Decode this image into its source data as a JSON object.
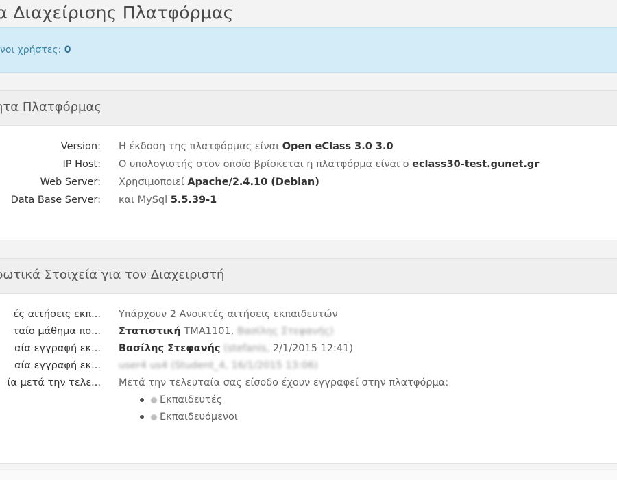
{
  "page_title": "εία Διαχείρισης Πλατφόρμας",
  "alert": {
    "label": "εμένοι χρήστες:",
    "value": "0"
  },
  "platform_panel": {
    "title": "ητα Πλατφόρμας",
    "rows": [
      {
        "label": "Version:",
        "text": "Η έκδοση της πλατφόρμας είναι",
        "bold": "Open eClass 3.0 3.0",
        "after": ""
      },
      {
        "label": "IP Host:",
        "text": "Ο υπολογιστής στον οποίο βρίσκεται η πλατφόρμα είναι ο",
        "bold": "eclass30-test.gunet.gr",
        "after": ""
      },
      {
        "label": "Web Server:",
        "text": "Χρησιμοποιεί",
        "bold": "Apache/2.4.10 (Debian)",
        "after": ""
      },
      {
        "label": "Data Base Server:",
        "text": "και MySql",
        "bold": "5.5.39-1",
        "after": ""
      }
    ]
  },
  "admin_panel": {
    "title": "ρωτικά Στοιχεία για τον Διαχειριστή",
    "rows": [
      {
        "label": "ές αιτήσεις εκπ...",
        "text": "Υπάρχουν 2 Ανοικτές αιτήσεις εκπαιδευτών"
      },
      {
        "label": "ταίο μάθημα πο...",
        "bold": "Στατιστική",
        "text": "TMA1101,",
        "blurred": "Βασίλης Στεφανής)"
      },
      {
        "label": "αία εγγραφή εκ...",
        "bold": "Βασίλης Στεφανής",
        "blurred": "(stefanis,",
        "text": "2/1/2015 12:41)"
      },
      {
        "label": "αία εγγραφή εκ...",
        "blurred": "user4 us4 (Student_4, 16/1/2015 13:06)"
      },
      {
        "label": "ία μετά την τελε...",
        "text": "Μετά την τελευταία σας είσοδο έχουν εγγραφεί στην πλατφόρμα:"
      }
    ],
    "bullets": [
      "Εκπαιδευτές",
      "Εκπαιδευόμενοι"
    ]
  }
}
